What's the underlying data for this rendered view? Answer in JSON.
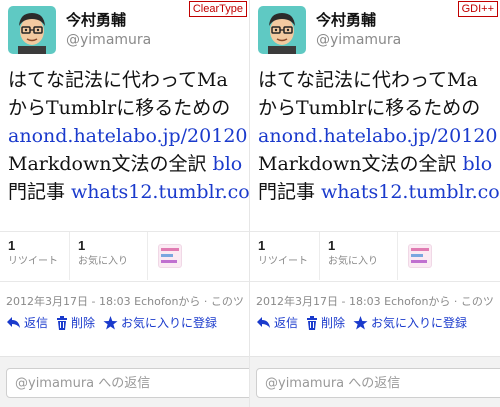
{
  "panels": [
    {
      "renderer_label": "ClearType",
      "user": {
        "name": "今村勇輔",
        "handle": "@yimamura"
      },
      "tweet": {
        "line1": "はてな記法に代わってMa",
        "line2": "からTumblrに移るための",
        "link1": "anond.hatelabo.jp/20120",
        "line4_text": "Markdown文法の全訳 ",
        "line4_link": "blo",
        "line5_text": "門記事 ",
        "line5_link": "whats12.tumblr.co"
      },
      "stats": {
        "retweets": "1",
        "retweets_label": "リツイート",
        "favorites": "1",
        "favorites_label": "お気に入り"
      },
      "meta": "2012年3月17日 - 18:03 Echofonから · このツ",
      "actions": {
        "reply": "返信",
        "delete": "削除",
        "favorite": "お気に入りに登録"
      },
      "reply_placeholder": "@yimamura への返信"
    },
    {
      "renderer_label": "GDI++",
      "user": {
        "name": "今村勇輔",
        "handle": "@yimamura"
      },
      "tweet": {
        "line1": "はてな記法に代わってMa",
        "line2": "からTumblrに移るための",
        "link1": "anond.hatelabo.jp/20120",
        "line4_text": "Markdown文法の全訳 ",
        "line4_link": "blo",
        "line5_text": "門記事 ",
        "line5_link": "whats12.tumblr.co"
      },
      "stats": {
        "retweets": "1",
        "retweets_label": "リツイート",
        "favorites": "1",
        "favorites_label": "お気に入り"
      },
      "meta": "2012年3月17日 - 18:03 Echofonから · このツ",
      "actions": {
        "reply": "返信",
        "delete": "削除",
        "favorite": "お気に入りに登録"
      },
      "reply_placeholder": "@yimamura への返信"
    }
  ],
  "colors": {
    "link": "#1a3acc",
    "badge": "#c00000",
    "muted": "#8a8a8a"
  },
  "icons": [
    "reply-icon",
    "trash-icon",
    "star-icon"
  ]
}
